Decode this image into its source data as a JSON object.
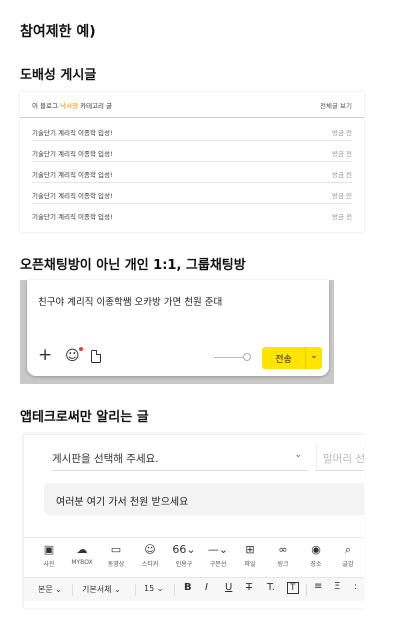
{
  "headings": {
    "main": "참여제한 예)",
    "spam": "도배성 게시글",
    "chat": "오픈채팅방이 아닌 개인 1:1, 그룹채팅방",
    "app": "앱테크로써만 알리는 글"
  },
  "blog": {
    "header_prefix": "이 블로그",
    "header_category": "낙서장",
    "header_suffix": "카테고리 글",
    "view_all": "전체글 보기",
    "rows": [
      {
        "title": "기술단기 계리직 이종학 입성!",
        "time": "방금 전"
      },
      {
        "title": "기술단기 계리직 이종학 입성!",
        "time": "방금 전"
      },
      {
        "title": "기술단기 계리직 이종학 입성!",
        "time": "방금 전"
      },
      {
        "title": "기술단기 계리직 이종학 입성!",
        "time": "방금 전"
      },
      {
        "title": "기술단기 계리직 이종학 입성!",
        "time": "방금 전"
      }
    ]
  },
  "chat": {
    "message": "친구야 계리직 이종학쌤 오카방 가면 천원 준대",
    "send_label": "전송",
    "colors": {
      "send": "#fee500",
      "notify_dot": "#f03a2e"
    }
  },
  "editor": {
    "board_placeholder": "게시판을 선택해 주세요.",
    "prefix_placeholder": "말머리 선",
    "title_value": "여러분 여기 가서 천원 받으세요",
    "tools": [
      {
        "icon": "photo-icon",
        "label": "사진"
      },
      {
        "icon": "mybox-icon",
        "label": "MYBOX"
      },
      {
        "icon": "video-icon",
        "label": "동영상"
      },
      {
        "icon": "sticker-icon",
        "label": "스티커"
      },
      {
        "icon": "quote-icon",
        "label": "인용구"
      },
      {
        "icon": "divider-icon",
        "label": "구분선"
      },
      {
        "icon": "file-icon",
        "label": "파일"
      },
      {
        "icon": "link-icon",
        "label": "링크"
      },
      {
        "icon": "place-icon",
        "label": "장소"
      },
      {
        "icon": "search-icon",
        "label": "글감"
      }
    ],
    "format": {
      "paragraph": "본문",
      "font": "기본서체",
      "size": "15"
    }
  }
}
